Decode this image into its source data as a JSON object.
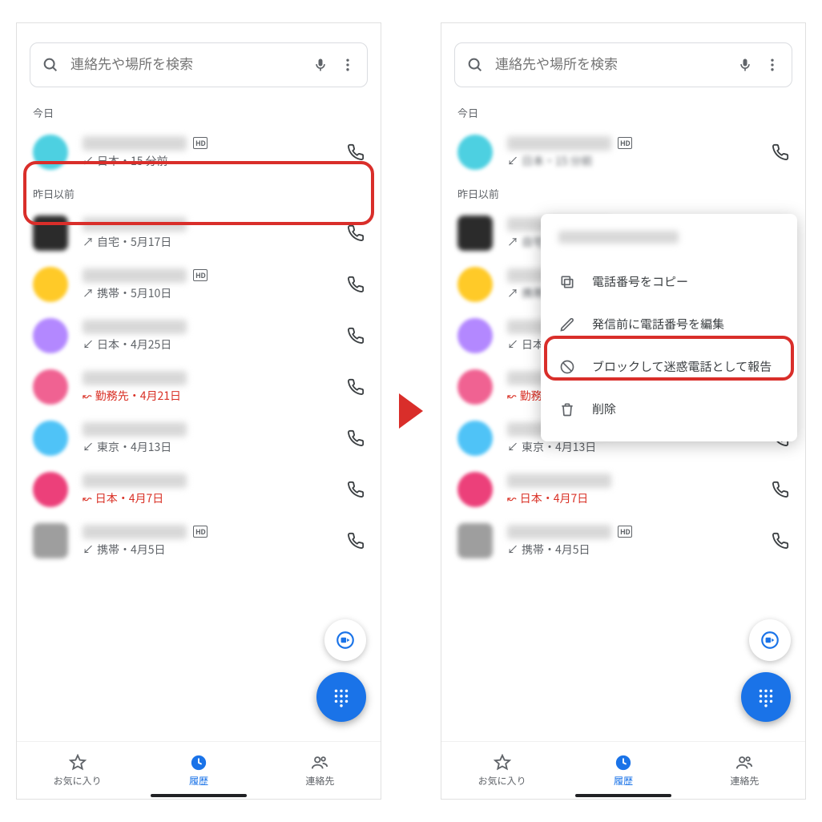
{
  "search": {
    "placeholder": "連絡先や場所を検索"
  },
  "sections": {
    "today": "今日",
    "earlier": "昨日以前"
  },
  "calls": [
    {
      "avatar_color": "#4dd0e1",
      "sub_prefix": "↙",
      "sub": "日本・15 分前",
      "hd": true,
      "missed": false,
      "sq": false
    },
    {
      "avatar_color": "#2b2b2b",
      "sub_prefix": "↗",
      "sub": "自宅・5月17日",
      "hd": false,
      "missed": false,
      "sq": true
    },
    {
      "avatar_color": "#ffca28",
      "sub_prefix": "↗",
      "sub": "携帯・5月10日",
      "hd": true,
      "missed": false,
      "sq": false
    },
    {
      "avatar_color": "#b388ff",
      "sub_prefix": "↙",
      "sub": "日本・4月25日",
      "hd": false,
      "missed": false,
      "sq": false
    },
    {
      "avatar_color": "#f06292",
      "sub_prefix": "↜",
      "sub": "勤務先・4月21日",
      "hd": false,
      "missed": true,
      "sq": false
    },
    {
      "avatar_color": "#4fc3f7",
      "sub_prefix": "↙",
      "sub": "東京・4月13日",
      "hd": false,
      "missed": false,
      "sq": false
    },
    {
      "avatar_color": "#ec407a",
      "sub_prefix": "↜",
      "sub": "日本・4月7日",
      "hd": false,
      "missed": true,
      "sq": false
    },
    {
      "avatar_color": "#9e9e9e",
      "sub_prefix": "↙",
      "sub": "携帯・4月5日",
      "hd": true,
      "missed": false,
      "sq": true
    }
  ],
  "right_screen_first_sub": "日本・15 分前",
  "nav": {
    "favorites": "お気に入り",
    "history": "履歴",
    "contacts": "連絡先"
  },
  "menu": {
    "copy": "電話番号をコピー",
    "edit": "発信前に電話番号を編集",
    "block": "ブロックして迷惑電話として報告",
    "delete": "削除"
  }
}
